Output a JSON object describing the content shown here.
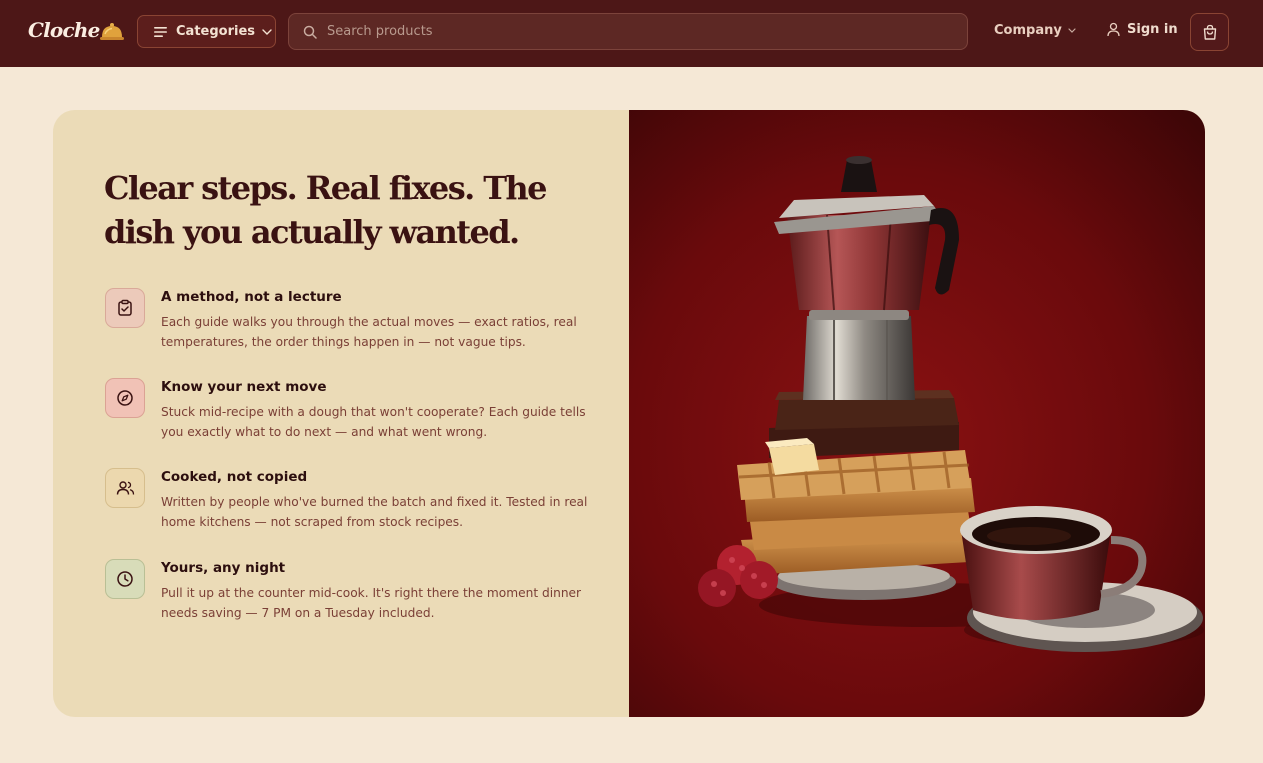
{
  "header": {
    "logo": "Cloche",
    "categories_label": "Categories",
    "search_placeholder": "Search products",
    "company_label": "Company",
    "signin_label": "Sign in"
  },
  "hero": {
    "headline": "Clear steps. Real fixes. The dish you actually wanted.",
    "features": [
      {
        "title": "A method, not a lecture",
        "description": "Each guide walks you through the actual moves — exact ratios, real temperatures, the order things happen in — not vague tips.",
        "icon": "clipboard-check-icon",
        "icon_bg": "#eccaba"
      },
      {
        "title": "Know your next move",
        "description": "Stuck mid-recipe with a dough that won't cooperate? Each guide tells you exactly what to do next — and what went wrong.",
        "icon": "compass-icon",
        "icon_bg": "#f1c2b6"
      },
      {
        "title": "Cooked, not copied",
        "description": "Written by people who've burned the batch and fixed it. Tested in real home kitchens — not scraped from stock recipes.",
        "icon": "users-icon",
        "icon_bg": "#ecd8ae"
      },
      {
        "title": "Yours, any night",
        "description": "Pull it up at the counter mid-cook. It's right there the moment dinner needs saving — 7 PM on a Tuesday included.",
        "icon": "clock-icon",
        "icon_bg": "#d8dcb9"
      }
    ]
  },
  "colors": {
    "header_bg": "#4d1717",
    "page_bg": "#f5e8d6",
    "card_bg": "#ebdbb7",
    "photo_bg": "#7a0d0f",
    "headline": "#3a1212"
  }
}
